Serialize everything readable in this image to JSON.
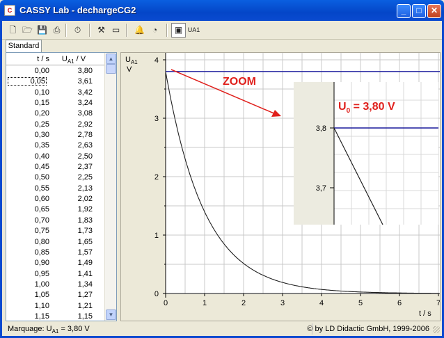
{
  "window": {
    "title": "CASSY Lab - dechargeCG2",
    "app_icon": "cassy-icon"
  },
  "toolbar": {
    "items": [
      {
        "icon": "new-file-icon",
        "glyph": "🗋"
      },
      {
        "icon": "open-file-icon",
        "glyph": "🗁"
      },
      {
        "icon": "save-file-icon",
        "glyph": "💾"
      },
      {
        "icon": "print-icon",
        "glyph": "⎙"
      },
      {
        "icon": "stopwatch-icon",
        "glyph": "⏱"
      },
      {
        "icon": "tools-icon",
        "glyph": "⚒"
      },
      {
        "icon": "display-icon",
        "glyph": "▭"
      },
      {
        "icon": "bell-icon",
        "glyph": "🔔"
      },
      {
        "icon": "gauge-icon",
        "glyph": "◔"
      },
      {
        "icon": "window-icon",
        "glyph": "▣"
      },
      {
        "icon": "ua1-icon",
        "glyph": "UA1"
      }
    ]
  },
  "tabs": [
    {
      "label": "Standard"
    }
  ],
  "table": {
    "headers": {
      "t": "t / s",
      "u_main": "U",
      "u_sub": "A1",
      "u_unit": " / V"
    },
    "rows": [
      [
        "0,00",
        "3,80"
      ],
      [
        "0,05",
        "3,61"
      ],
      [
        "0,10",
        "3,42"
      ],
      [
        "0,15",
        "3,24"
      ],
      [
        "0,20",
        "3,08"
      ],
      [
        "0,25",
        "2,92"
      ],
      [
        "0,30",
        "2,78"
      ],
      [
        "0,35",
        "2,63"
      ],
      [
        "0,40",
        "2,50"
      ],
      [
        "0,45",
        "2,37"
      ],
      [
        "0,50",
        "2,25"
      ],
      [
        "0,55",
        "2,13"
      ],
      [
        "0,60",
        "2,02"
      ],
      [
        "0,65",
        "1,92"
      ],
      [
        "0,70",
        "1,83"
      ],
      [
        "0,75",
        "1,73"
      ],
      [
        "0,80",
        "1,65"
      ],
      [
        "0,85",
        "1,57"
      ],
      [
        "0,90",
        "1,49"
      ],
      [
        "0,95",
        "1,41"
      ],
      [
        "1,00",
        "1,34"
      ],
      [
        "1,05",
        "1,27"
      ],
      [
        "1,10",
        "1,21"
      ],
      [
        "1,15",
        "1,15"
      ]
    ],
    "selected_row": 1
  },
  "chart_data": {
    "type": "line",
    "ylabel_main": "U",
    "ylabel_sub": "A1",
    "ylabel_unit": "V",
    "xlabel": "t / s",
    "xlim": [
      0,
      7
    ],
    "ylim": [
      0,
      4
    ],
    "xticks": [
      "0",
      "1",
      "2",
      "3",
      "4",
      "5",
      "6",
      "7"
    ],
    "yticks": [
      "0",
      "1",
      "2",
      "3",
      "4"
    ],
    "grid": true,
    "series": [
      {
        "color": "#202020",
        "tau": 1.0,
        "u0": 3.8
      }
    ],
    "marker_line": {
      "y": 3.8,
      "color": "#1a1a9c"
    },
    "annotation": {
      "text": "ZOOM",
      "color": "#e0201c"
    },
    "zoom": {
      "label_main": "U",
      "label_sub": "0",
      "label_rest": " = 3,80 V",
      "yticks": [
        "3,8",
        "3,7"
      ]
    }
  },
  "status": {
    "marker_label": "Marquage:  U",
    "marker_sub": "A1",
    "marker_value": " =  3,80 V",
    "copyright": "© by LD Didactic GmbH, 1999-2006"
  }
}
